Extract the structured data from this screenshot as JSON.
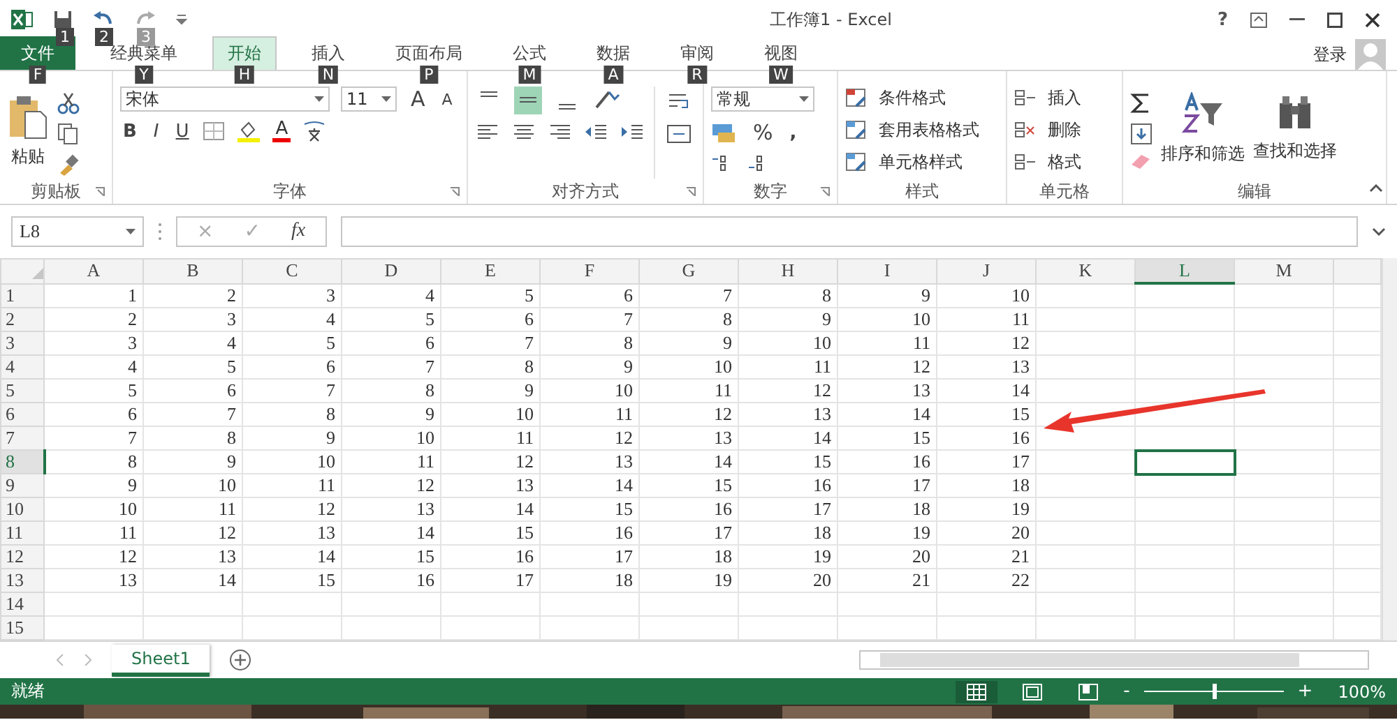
{
  "title_bar": {
    "quick_access_keytips": [
      "1",
      "2",
      "3"
    ],
    "title": "工作簿1 - Excel",
    "help": "?",
    "sign_in": "登录"
  },
  "tabs": [
    {
      "label": "文件",
      "keytip": "F",
      "kind": "file",
      "selected": false
    },
    {
      "label": "经典菜单",
      "keytip": "Y",
      "kind": "tab",
      "selected": false
    },
    {
      "label": "开始",
      "keytip": "H",
      "kind": "tab",
      "selected": true
    },
    {
      "label": "插入",
      "keytip": "N",
      "kind": "tab",
      "selected": false
    },
    {
      "label": "页面布局",
      "keytip": "P",
      "kind": "tab",
      "selected": false
    },
    {
      "label": "公式",
      "keytip": "M",
      "kind": "tab",
      "selected": false
    },
    {
      "label": "数据",
      "keytip": "A",
      "kind": "tab",
      "selected": false
    },
    {
      "label": "审阅",
      "keytip": "R",
      "kind": "tab",
      "selected": false
    },
    {
      "label": "视图",
      "keytip": "W",
      "kind": "tab",
      "selected": false
    }
  ],
  "ribbon": {
    "clipboard": {
      "paste": "粘贴",
      "label": "剪贴板"
    },
    "font": {
      "font_name": "宋体",
      "font_size": "11",
      "grow": "A",
      "shrink": "A",
      "bold": "B",
      "italic": "I",
      "underline": "U",
      "font_color": "A",
      "label": "字体"
    },
    "alignment": {
      "label": "对齐方式"
    },
    "number": {
      "format": "常规",
      "percent": "%",
      "comma": ",",
      "label": "数字"
    },
    "styles": {
      "items": [
        "条件格式",
        "套用表格格式",
        "单元格样式"
      ],
      "label": "样式"
    },
    "cells": {
      "items": [
        "插入",
        "删除",
        "格式"
      ],
      "label": "单元格"
    },
    "editing": {
      "sort": "排序和筛选",
      "find": "查找和选择",
      "label": "编辑"
    }
  },
  "formula_bar": {
    "name_box": "L8",
    "cancel": "×",
    "enter": "✓",
    "function": "fx"
  },
  "columns": [
    {
      "label": "A",
      "selected": false
    },
    {
      "label": "B",
      "selected": false
    },
    {
      "label": "C",
      "selected": false
    },
    {
      "label": "D",
      "selected": false
    },
    {
      "label": "E",
      "selected": false
    },
    {
      "label": "F",
      "selected": false
    },
    {
      "label": "G",
      "selected": false
    },
    {
      "label": "H",
      "selected": false
    },
    {
      "label": "I",
      "selected": false
    },
    {
      "label": "J",
      "selected": false
    },
    {
      "label": "K",
      "selected": false
    },
    {
      "label": "L",
      "selected": true
    },
    {
      "label": "M",
      "selected": false
    }
  ],
  "rows": [
    {
      "header": "1",
      "selected": false,
      "cells": [
        "1",
        "2",
        "3",
        "4",
        "5",
        "6",
        "7",
        "8",
        "9",
        "10"
      ]
    },
    {
      "header": "2",
      "selected": false,
      "cells": [
        "2",
        "3",
        "4",
        "5",
        "6",
        "7",
        "8",
        "9",
        "10",
        "11"
      ]
    },
    {
      "header": "3",
      "selected": false,
      "cells": [
        "3",
        "4",
        "5",
        "6",
        "7",
        "8",
        "9",
        "10",
        "11",
        "12"
      ]
    },
    {
      "header": "4",
      "selected": false,
      "cells": [
        "4",
        "5",
        "6",
        "7",
        "8",
        "9",
        "10",
        "11",
        "12",
        "13"
      ]
    },
    {
      "header": "5",
      "selected": false,
      "cells": [
        "5",
        "6",
        "7",
        "8",
        "9",
        "10",
        "11",
        "12",
        "13",
        "14"
      ]
    },
    {
      "header": "6",
      "selected": false,
      "cells": [
        "6",
        "7",
        "8",
        "9",
        "10",
        "11",
        "12",
        "13",
        "14",
        "15"
      ]
    },
    {
      "header": "7",
      "selected": false,
      "cells": [
        "7",
        "8",
        "9",
        "10",
        "11",
        "12",
        "13",
        "14",
        "15",
        "16"
      ]
    },
    {
      "header": "8",
      "selected": true,
      "cells": [
        "8",
        "9",
        "10",
        "11",
        "12",
        "13",
        "14",
        "15",
        "16",
        "17"
      ]
    },
    {
      "header": "9",
      "selected": false,
      "cells": [
        "9",
        "10",
        "11",
        "12",
        "13",
        "14",
        "15",
        "16",
        "17",
        "18"
      ]
    },
    {
      "header": "10",
      "selected": false,
      "cells": [
        "10",
        "11",
        "12",
        "13",
        "14",
        "15",
        "16",
        "17",
        "18",
        "19"
      ]
    },
    {
      "header": "11",
      "selected": false,
      "cells": [
        "11",
        "12",
        "13",
        "14",
        "15",
        "16",
        "17",
        "18",
        "19",
        "20"
      ]
    },
    {
      "header": "12",
      "selected": false,
      "cells": [
        "12",
        "13",
        "14",
        "15",
        "16",
        "17",
        "18",
        "19",
        "20",
        "21"
      ]
    },
    {
      "header": "13",
      "selected": false,
      "cells": [
        "13",
        "14",
        "15",
        "16",
        "17",
        "18",
        "19",
        "20",
        "21",
        "22"
      ]
    },
    {
      "header": "14",
      "selected": false,
      "cells": []
    },
    {
      "header": "15",
      "selected": false,
      "cells": []
    }
  ],
  "sheet_tabs": [
    {
      "label": "Sheet1",
      "selected": true
    }
  ],
  "status_bar": {
    "status": "就绪",
    "views": [
      {
        "kind": "normal",
        "selected": true
      },
      {
        "kind": "layout",
        "selected": false
      },
      {
        "kind": "pagebreak",
        "selected": false
      }
    ],
    "zoom": {
      "minus": "-",
      "plus": "+",
      "level": 0.5,
      "reading": "100%"
    }
  }
}
